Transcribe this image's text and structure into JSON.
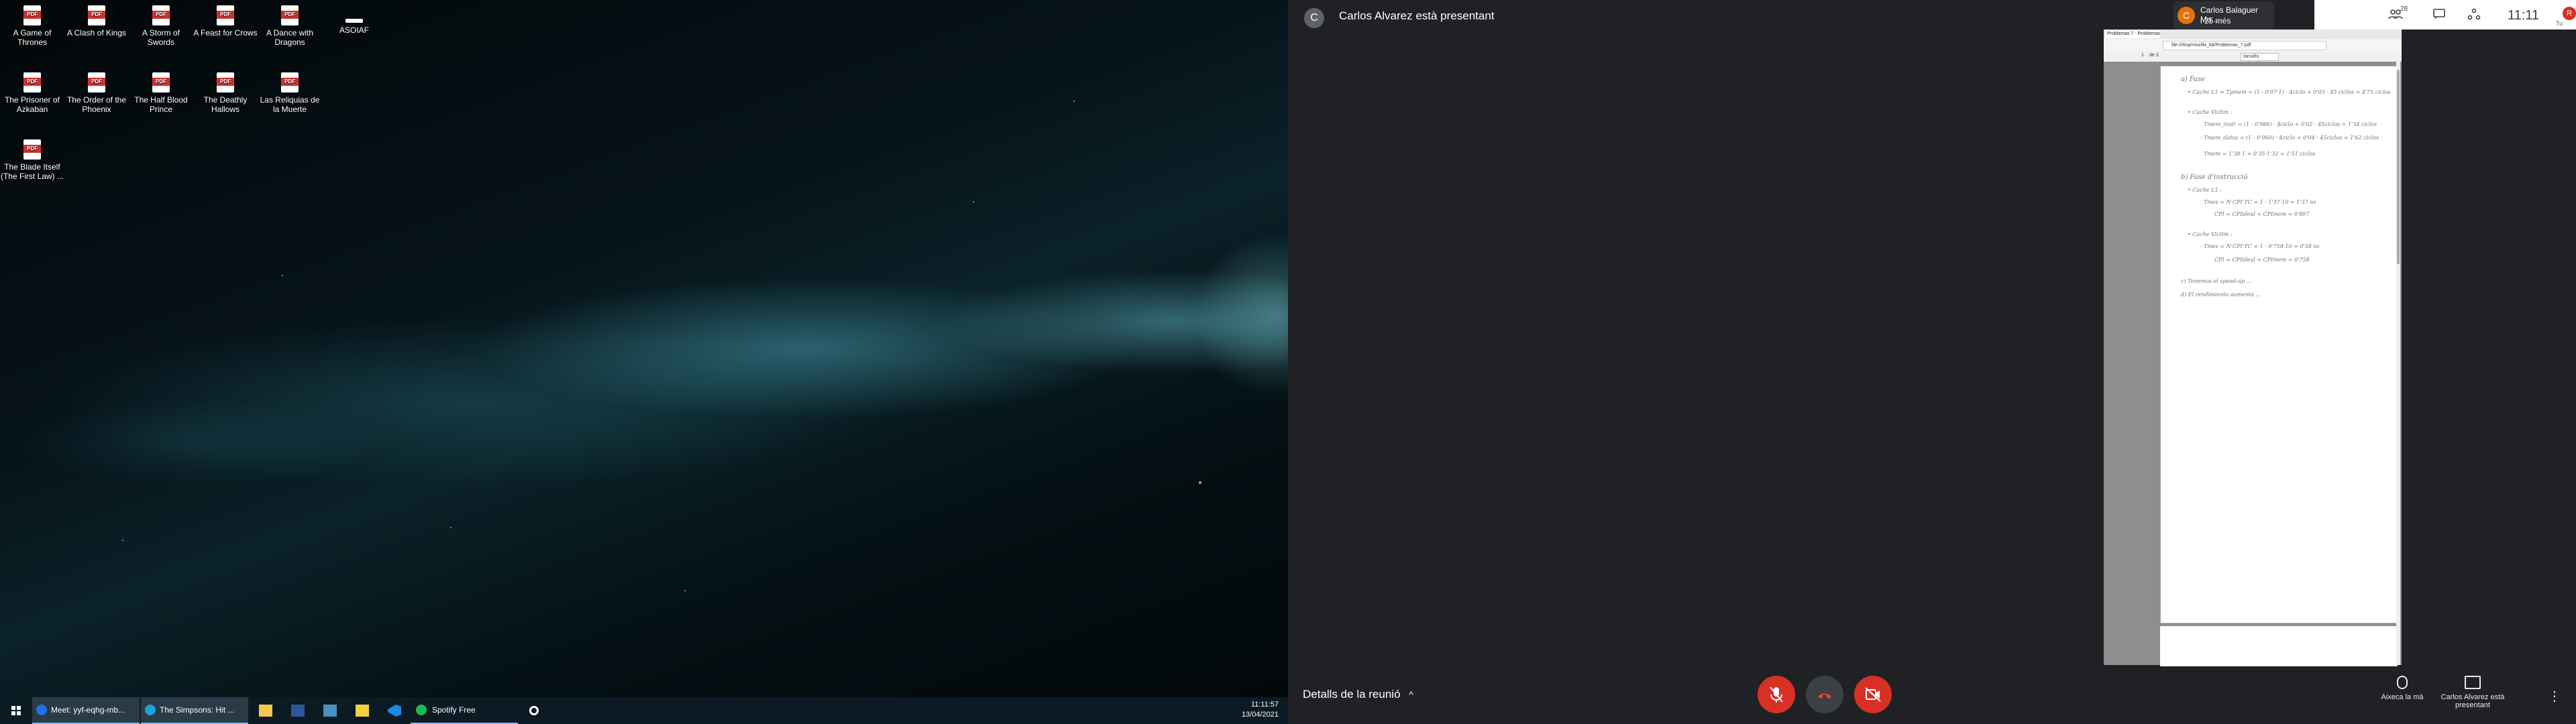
{
  "desktop": {
    "icons": [
      {
        "label": "A Game of Thrones",
        "type": "pdf"
      },
      {
        "label": "A Clash of Kings",
        "type": "pdf"
      },
      {
        "label": "A Storm of Swords",
        "type": "pdf"
      },
      {
        "label": "A Feast for Crows",
        "type": "pdf"
      },
      {
        "label": "A Dance with Dragons",
        "type": "pdf"
      },
      {
        "label": "ASOIAF",
        "type": "folder"
      },
      {
        "label": "The Prisoner of Azkaban",
        "type": "pdf"
      },
      {
        "label": "The Order of the Phoenix",
        "type": "pdf"
      },
      {
        "label": "The Half Blood Prince",
        "type": "pdf"
      },
      {
        "label": "The Deathly Hallows",
        "type": "pdf"
      },
      {
        "label": "Las Reliquias de la Muerte",
        "type": "pdf"
      },
      {
        "label": "The Blade Itself (The First Law) ...",
        "type": "pdf"
      }
    ]
  },
  "taskbar": {
    "apps": [
      {
        "label": "Meet: yyf-eqhg-mb...",
        "icon": "meet-icon"
      },
      {
        "label": "The Simpsons: Hit ...",
        "icon": "edge-icon"
      }
    ],
    "spotify": "Spotify Free",
    "time": "11:11:57",
    "date": "13/04/2021"
  },
  "meet": {
    "presenter_initial": "C",
    "presenting_text": "Carlos Alvarez està presentant",
    "tile": {
      "initial": "C",
      "name": "Carlos Balaguer Mo...",
      "sub": "i 25 més"
    },
    "participants_count": "28",
    "clock": "11:11",
    "user_initial": "R",
    "user_sub": "Tu",
    "details": "Detalls de la reunió",
    "raise_hand": "Aixeca la mà",
    "presenting_short": "Carlos Alvarez està presentant",
    "colors": {
      "end_call": "#d93025",
      "mute": "#d93025",
      "bg": "#202124"
    }
  },
  "browser": {
    "tab": "Problemas 7 - Problemas_7.p...",
    "url": "file:///tmp/mozilla_kb/Problemas_7.pdf",
    "page": "1",
    "page_of": "de 3",
    "zoom": "tamaño automático"
  },
  "document_text": [
    "a) Fase",
    "• Cache L1 ⇒ Tμmem = (1 - 0'97·1) · 4ciclo + 0'03 · 45 ciclos = 4'75 ciclos",
    "• Cache Victim :",
    "Tmem_instr = (1 - 0'986) · 4ciclo + 0'02 · 45ciclos = 1'34 ciclos",
    "Tmem_datos = (1 - 0'960) · 4ciclo + 0'04 · 45ciclos = 1'62 ciclos",
    "Tmem = 1'38·1 + 0'35·1'32 = 1'51 ciclos",
    "b) Fase d'instrucció",
    "• Cache L1 :",
    "Tmes = N·CPI·TC = 1 · 1'37·10 = 1'37 ns",
    "CPI = CPIideal + CPImem = 0'897",
    "• Cache Victim :",
    "Tmes = N·CPI·TC = 1 · 0'758·10 = 0'58 ns",
    "CPI = CPIideal + CPImem = 0'758",
    "c) Tenemos el speed-up ...",
    "d) El rendimiento aumenta ..."
  ]
}
